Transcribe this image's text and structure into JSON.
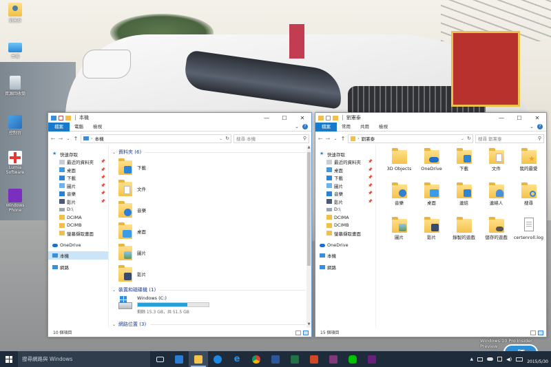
{
  "desktop": {
    "icons": [
      {
        "label": "劉憲泰",
        "icon": "user-folder-icon"
      },
      {
        "label": "本機",
        "icon": "computer-icon"
      },
      {
        "label": "資源回收筒",
        "icon": "recycle-bin-icon"
      },
      {
        "label": "控制台",
        "icon": "control-panel-icon"
      },
      {
        "label": "Lumia Software",
        "icon": "lumia-icon"
      },
      {
        "label": "Windows Phone",
        "icon": "windows-phone-icon"
      }
    ],
    "watermark": "Windows 10 Pro Insider Preview"
  },
  "left_window": {
    "title": "本機",
    "ribbon_tabs": [
      "檔案",
      "電腦",
      "檢視"
    ],
    "address": "本機",
    "search_placeholder": "搜尋 本機",
    "nav": {
      "quick_access": "快速存取",
      "items": [
        {
          "label": "最近的資料夾",
          "pinned": true
        },
        {
          "label": "桌面",
          "pinned": true
        },
        {
          "label": "下載",
          "pinned": true
        },
        {
          "label": "圖片",
          "pinned": true
        },
        {
          "label": "音樂",
          "pinned": true
        },
        {
          "label": "影片",
          "pinned": true
        },
        {
          "label": "D:\\",
          "pinned": false
        },
        {
          "label": "DCIMA",
          "pinned": false
        },
        {
          "label": "DCIMB",
          "pinned": false
        },
        {
          "label": "螢幕擷取畫面",
          "pinned": false
        }
      ],
      "onedrive": "OneDrive",
      "this_pc": "本機",
      "network": "網路"
    },
    "groups": {
      "folders_header": "資料夾 (6)",
      "devices_header": "裝置和磁碟機 (1)",
      "network_header": "網路位置 (3)"
    },
    "folders": [
      {
        "label": "下載",
        "icon": "downloads-folder-icon"
      },
      {
        "label": "文件",
        "icon": "documents-folder-icon"
      },
      {
        "label": "音樂",
        "icon": "music-folder-icon"
      },
      {
        "label": "桌面",
        "icon": "desktop-folder-icon"
      },
      {
        "label": "圖片",
        "icon": "pictures-folder-icon"
      },
      {
        "label": "影片",
        "icon": "videos-folder-icon"
      }
    ],
    "drive": {
      "label": "Windows (C:)",
      "free_text": "剩餘 15.3 GB，共 51.5 GB",
      "used_fraction": 0.7
    },
    "status": "10 個項目"
  },
  "right_window": {
    "title": "劉憲泰",
    "ribbon_tabs": [
      "檔案",
      "常用",
      "共用",
      "檢視"
    ],
    "address": "劉憲泰",
    "search_placeholder": "搜尋 劉憲泰",
    "nav": {
      "quick_access": "快速存取",
      "items": [
        {
          "label": "最近的資料夾",
          "pinned": true
        },
        {
          "label": "桌面",
          "pinned": true
        },
        {
          "label": "下載",
          "pinned": true
        },
        {
          "label": "圖片",
          "pinned": true
        },
        {
          "label": "音樂",
          "pinned": true
        },
        {
          "label": "影片",
          "pinned": true
        },
        {
          "label": "D:\\",
          "pinned": false
        },
        {
          "label": "DCIMA",
          "pinned": false
        },
        {
          "label": "DCIMB",
          "pinned": false
        },
        {
          "label": "螢幕擷取畫面",
          "pinned": false
        }
      ],
      "onedrive": "OneDrive",
      "this_pc": "本機",
      "network": "網路"
    },
    "items": [
      {
        "label": "3D Objects",
        "icon": "3d-objects-folder-icon"
      },
      {
        "label": "OneDrive",
        "icon": "onedrive-folder-icon"
      },
      {
        "label": "下載",
        "icon": "downloads-folder-icon"
      },
      {
        "label": "文件",
        "icon": "documents-folder-icon"
      },
      {
        "label": "我的最愛",
        "icon": "favorites-folder-icon"
      },
      {
        "label": "音樂",
        "icon": "music-folder-icon"
      },
      {
        "label": "桌面",
        "icon": "desktop-folder-icon"
      },
      {
        "label": "連結",
        "icon": "links-folder-icon"
      },
      {
        "label": "連絡人",
        "icon": "contacts-folder-icon"
      },
      {
        "label": "搜尋",
        "icon": "searches-folder-icon"
      },
      {
        "label": "圖片",
        "icon": "pictures-folder-icon"
      },
      {
        "label": "影片",
        "icon": "videos-folder-icon"
      },
      {
        "label": "錄製的遊戲",
        "icon": "saved-games-folder-icon"
      },
      {
        "label": "儲存的遊戲",
        "icon": "saved-games-folder-icon"
      },
      {
        "label": "certenroll.log",
        "icon": "log-file-icon"
      }
    ],
    "status": "15 個項目"
  },
  "taskbar": {
    "search_placeholder": "搜尋網路與 Windows",
    "apps": [
      {
        "name": "task-view-icon",
        "color": "#1d2b3a"
      },
      {
        "name": "store-icon",
        "color": "#2b7cd3"
      },
      {
        "name": "file-explorer-icon",
        "color": "#f3c34d"
      },
      {
        "name": "app-icon",
        "color": "#1e88e5"
      },
      {
        "name": "edge-icon",
        "color": "#2f8fe0"
      },
      {
        "name": "chrome-icon",
        "color": "#e3a321"
      },
      {
        "name": "word-icon",
        "color": "#2b579a"
      },
      {
        "name": "excel-icon",
        "color": "#217346"
      },
      {
        "name": "powerpoint-icon",
        "color": "#d24726"
      },
      {
        "name": "onenote-icon",
        "color": "#80397b"
      },
      {
        "name": "line-icon",
        "color": "#00c300"
      },
      {
        "name": "visual-studio-icon",
        "color": "#68217a"
      }
    ],
    "date": "2015/5/30"
  },
  "colors": {
    "accent": "#1979ca",
    "file_tab": "#1979ca",
    "selection": "#cce4f7",
    "taskbar": "#1d2b3a"
  }
}
